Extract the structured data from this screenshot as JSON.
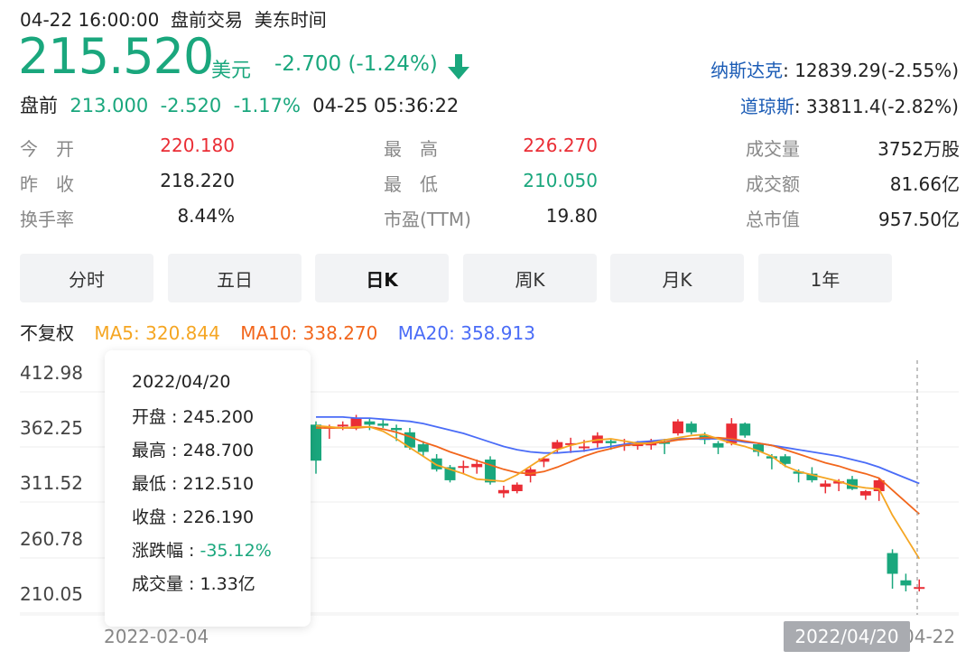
{
  "header": {
    "datetime": "04-22 16:00:00",
    "session": "盘前交易",
    "timezone": "美东时间",
    "price": "215.520",
    "currency": "美元",
    "change": "-2.700 (-1.24%)",
    "arrow_icon": "down-arrow-icon",
    "premarket": {
      "label": "盘前",
      "price": "213.000",
      "change": "-2.520",
      "pct": "-1.17%",
      "time": "04-25 05:36:22"
    }
  },
  "indices": [
    {
      "name": "纳斯达克",
      "value": ": 12839.29(-2.55%)"
    },
    {
      "name": "道琼斯",
      "value": ": 33811.4(-2.82%)"
    }
  ],
  "stats": [
    {
      "label": "今　开",
      "value": "220.180",
      "color": "red"
    },
    {
      "label": "昨　收",
      "value": "218.220",
      "color": "neutral"
    },
    {
      "label": "换手率",
      "value": "8.44%",
      "color": "neutral"
    },
    {
      "label": "最　高",
      "value": "226.270",
      "color": "red"
    },
    {
      "label": "最　低",
      "value": "210.050",
      "color": "green"
    },
    {
      "label": "市盈(TTM)",
      "value": "19.80",
      "color": "neutral"
    },
    {
      "label": "成交量",
      "value": "3752万股",
      "color": "neutral"
    },
    {
      "label": "成交额",
      "value": "81.66亿",
      "color": "neutral"
    },
    {
      "label": "总市值",
      "value": "957.50亿",
      "color": "neutral"
    }
  ],
  "tabs": [
    {
      "label": "分时",
      "active": false
    },
    {
      "label": "五日",
      "active": false
    },
    {
      "label": "日K",
      "active": true
    },
    {
      "label": "周K",
      "active": false
    },
    {
      "label": "月K",
      "active": false
    },
    {
      "label": "1年",
      "active": false
    }
  ],
  "ma": {
    "label": "不复权",
    "ma5": "MA5: 320.844",
    "ma10": "MA10: 338.270",
    "ma20": "MA20: 358.913"
  },
  "colors": {
    "up": "#ea2d35",
    "down": "#1aa77d",
    "ma5": "#f5a623",
    "ma10": "#f2661c",
    "ma20": "#4a6cf7"
  },
  "tooltip": {
    "date": "2022/04/20",
    "open": "开盘 : 245.200",
    "high": "最高 : 248.700",
    "low": "最低 : 212.510",
    "close": "收盘 : 226.190",
    "change_label": "涨跌幅 : ",
    "change_value": "-35.12%",
    "volume": "成交量 : 1.33亿"
  },
  "chart_data": {
    "type": "candlestick",
    "y_ticks": [
      "412.98",
      "362.25",
      "311.52",
      "260.78",
      "210.05"
    ],
    "ylim": [
      200,
      420
    ],
    "x_labels": [
      "2022-02-04",
      "2022/04/20",
      "04-22"
    ],
    "candles": [
      {
        "o": 363,
        "h": 366,
        "l": 318,
        "c": 330
      },
      {
        "o": 360,
        "h": 363,
        "l": 350,
        "c": 361
      },
      {
        "o": 362,
        "h": 366,
        "l": 358,
        "c": 363
      },
      {
        "o": 361,
        "h": 372,
        "l": 358,
        "c": 369
      },
      {
        "o": 366,
        "h": 369,
        "l": 358,
        "c": 363
      },
      {
        "o": 364,
        "h": 368,
        "l": 360,
        "c": 362
      },
      {
        "o": 360,
        "h": 363,
        "l": 348,
        "c": 358
      },
      {
        "o": 356,
        "h": 360,
        "l": 340,
        "c": 342
      },
      {
        "o": 345,
        "h": 348,
        "l": 334,
        "c": 338
      },
      {
        "o": 332,
        "h": 336,
        "l": 320,
        "c": 322
      },
      {
        "o": 324,
        "h": 326,
        "l": 310,
        "c": 312
      },
      {
        "o": 324,
        "h": 330,
        "l": 318,
        "c": 325
      },
      {
        "o": 324,
        "h": 331,
        "l": 318,
        "c": 327
      },
      {
        "o": 331,
        "h": 334,
        "l": 308,
        "c": 310
      },
      {
        "o": 300,
        "h": 307,
        "l": 296,
        "c": 303
      },
      {
        "o": 302,
        "h": 310,
        "l": 300,
        "c": 308
      },
      {
        "o": 316,
        "h": 324,
        "l": 310,
        "c": 322
      },
      {
        "o": 329,
        "h": 333,
        "l": 324,
        "c": 332
      },
      {
        "o": 341,
        "h": 349,
        "l": 337,
        "c": 347
      },
      {
        "o": 346,
        "h": 351,
        "l": 337,
        "c": 346
      },
      {
        "o": 343,
        "h": 349,
        "l": 338,
        "c": 343
      },
      {
        "o": 346,
        "h": 356,
        "l": 342,
        "c": 353
      },
      {
        "o": 348,
        "h": 350,
        "l": 340,
        "c": 346
      },
      {
        "o": 345,
        "h": 350,
        "l": 339,
        "c": 345
      },
      {
        "o": 345,
        "h": 348,
        "l": 340,
        "c": 345
      },
      {
        "o": 344,
        "h": 350,
        "l": 340,
        "c": 348
      },
      {
        "o": 347,
        "h": 350,
        "l": 336,
        "c": 346
      },
      {
        "o": 355,
        "h": 368,
        "l": 353,
        "c": 366
      },
      {
        "o": 364,
        "h": 366,
        "l": 354,
        "c": 356
      },
      {
        "o": 353,
        "h": 356,
        "l": 345,
        "c": 349
      },
      {
        "o": 346,
        "h": 348,
        "l": 336,
        "c": 342
      },
      {
        "o": 346,
        "h": 369,
        "l": 344,
        "c": 364
      },
      {
        "o": 364,
        "h": 365,
        "l": 351,
        "c": 353
      },
      {
        "o": 345,
        "h": 346,
        "l": 334,
        "c": 338
      },
      {
        "o": 334,
        "h": 336,
        "l": 322,
        "c": 332
      },
      {
        "o": 334,
        "h": 336,
        "l": 324,
        "c": 327
      },
      {
        "o": 320,
        "h": 322,
        "l": 310,
        "c": 318
      },
      {
        "o": 318,
        "h": 324,
        "l": 310,
        "c": 312
      },
      {
        "o": 306,
        "h": 312,
        "l": 300,
        "c": 309
      },
      {
        "o": 309,
        "h": 313,
        "l": 302,
        "c": 311
      },
      {
        "o": 313,
        "h": 316,
        "l": 303,
        "c": 304
      },
      {
        "o": 298,
        "h": 303,
        "l": 294,
        "c": 302
      },
      {
        "o": 302,
        "h": 314,
        "l": 293,
        "c": 312
      },
      {
        "o": 245.2,
        "h": 248.7,
        "l": 212.51,
        "c": 226.19
      },
      {
        "o": 220.18,
        "h": 226.27,
        "l": 210.05,
        "c": 215.52
      },
      {
        "o": 213,
        "h": 221,
        "l": 210,
        "c": 214
      }
    ],
    "ma5": [
      362,
      361,
      360,
      361,
      361,
      357,
      350,
      342,
      334,
      326,
      322,
      318,
      313,
      312,
      311,
      317,
      325,
      333,
      340,
      344,
      347,
      349,
      350,
      348,
      346,
      346,
      349,
      351,
      353,
      354,
      350,
      346,
      343,
      339,
      334,
      325,
      320,
      317,
      314,
      311,
      307,
      305,
      304,
      280,
      260,
      240
    ],
    "ma10": [
      360,
      360,
      360,
      360,
      361,
      359,
      356,
      352,
      347,
      343,
      338,
      334,
      330,
      326,
      322,
      319,
      318,
      320,
      324,
      329,
      334,
      338,
      341,
      344,
      345,
      346,
      347,
      349,
      350,
      351,
      351,
      350,
      348,
      346,
      344,
      340,
      336,
      332,
      328,
      325,
      321,
      318,
      314,
      303,
      292,
      281
    ],
    "ma20": [
      370,
      370,
      370,
      369,
      369,
      368,
      367,
      366,
      364,
      361,
      358,
      355,
      351,
      347,
      343,
      340,
      338,
      337,
      337,
      338,
      339,
      341,
      343,
      345,
      347,
      348,
      349,
      350,
      350,
      350,
      350,
      349,
      347,
      346,
      344,
      342,
      340,
      338,
      336,
      334,
      331,
      328,
      324,
      319,
      314,
      309
    ]
  }
}
